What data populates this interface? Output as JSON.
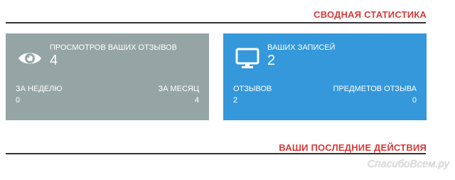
{
  "header": {
    "title": "СВОДНАЯ СТАТИСТИКА"
  },
  "cards": [
    {
      "icon": "eye-icon",
      "label": "ПРОСМОТРОВ ВАШИХ ОТЗЫВОВ",
      "value": "4",
      "left_label": "ЗА НЕДЕЛЮ",
      "left_value": "0",
      "right_label": "ЗА МЕСЯЦ",
      "right_value": "4",
      "color": "#95a5a6"
    },
    {
      "icon": "monitor-icon",
      "label": "ВАШИХ ЗАПИСЕЙ",
      "value": "2",
      "left_label": "ОТЗЫВОВ",
      "left_value": "2",
      "right_label": "ПРЕДМЕТОВ ОТЗЫВА",
      "right_value": "0",
      "color": "#3498db"
    }
  ],
  "recent": {
    "title": "ВАШИ ПОСЛЕДНИЕ ДЕЙСТВИЯ"
  },
  "watermark": "СпасибоВсем.ру",
  "colors": {
    "accent": "#d63a3a",
    "rule": "#333333"
  }
}
